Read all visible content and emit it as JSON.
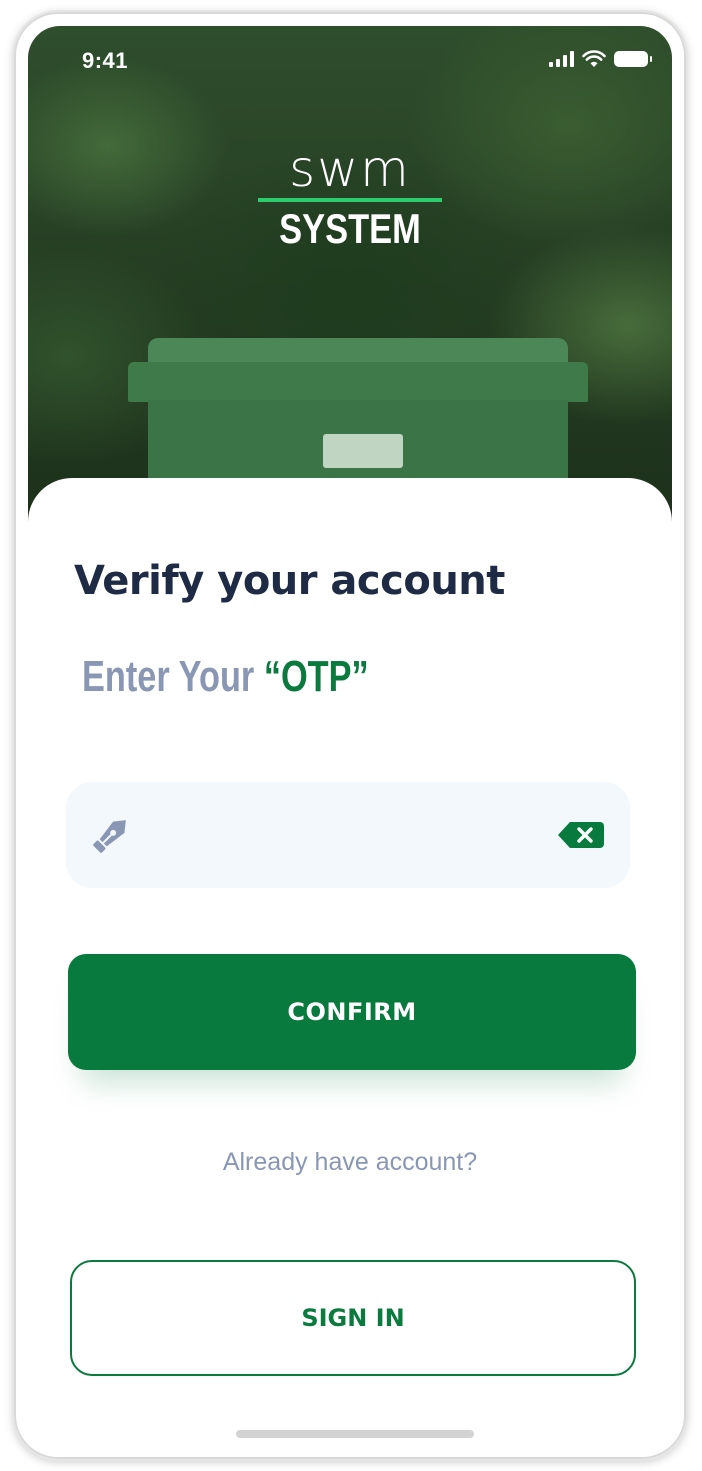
{
  "status_bar": {
    "time": "9:41",
    "icons": [
      "signal-icon",
      "wifi-icon",
      "battery-icon"
    ]
  },
  "logo": {
    "top_text": "swm",
    "bottom_text": "SYSTEM",
    "accent_color": "#2ecc71"
  },
  "verify": {
    "title": "Verify your account",
    "subtitle_prefix": "Enter Your ",
    "subtitle_highlight": "“OTP”"
  },
  "otp_field": {
    "value": "",
    "placeholder": "",
    "left_icon": "pen-nib-icon",
    "right_icon": "backspace-icon"
  },
  "actions": {
    "confirm_label": "CONFIRM",
    "already_text": "Already have account?",
    "signin_label": "SIGN IN"
  },
  "colors": {
    "primary": "#087a3e",
    "title": "#1f2a44",
    "muted": "#8a97b4",
    "field_bg": "#f3f8fd"
  }
}
